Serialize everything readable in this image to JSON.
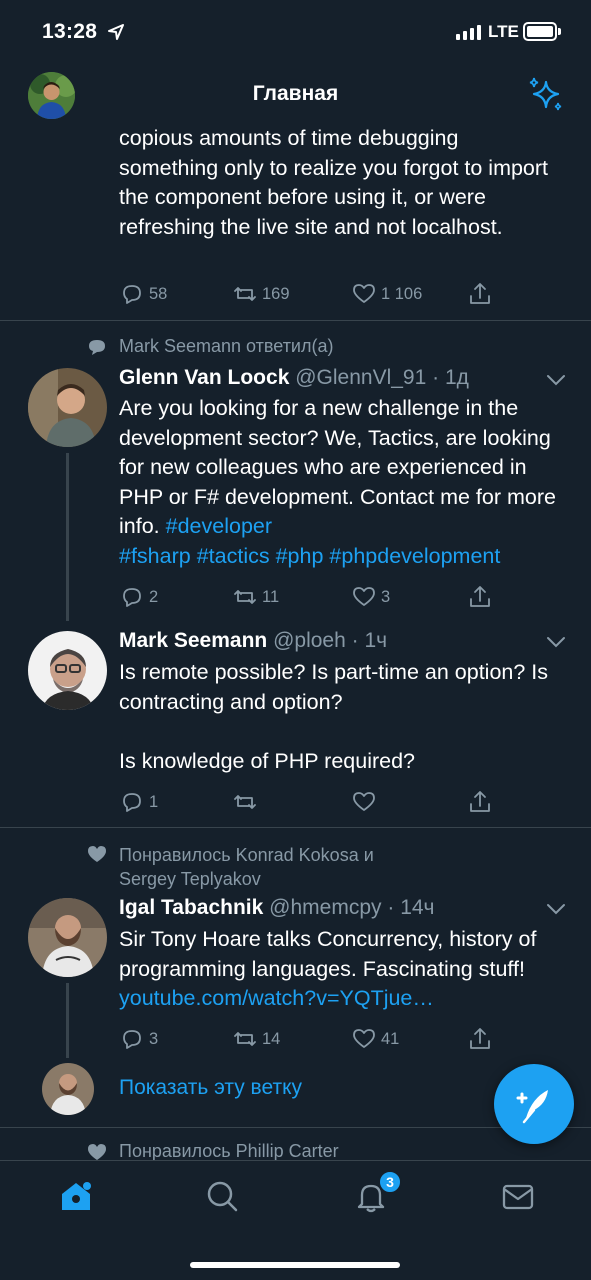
{
  "status_bar": {
    "time": "13:28",
    "network": "LTE"
  },
  "header": {
    "title": "Главная",
    "avatar_icon": "user-avatar",
    "sparkle_icon": "sparkle-icon"
  },
  "tweet_top": {
    "text": "copious amounts of time debugging something only to realize you forgot to import the component before using it, or were refreshing the live site and not localhost.",
    "replies": "58",
    "retweets": "169",
    "likes": "1 106"
  },
  "thread1": {
    "social_context": "Mark Seemann ответил(а)",
    "tweet1": {
      "name": "Glenn Van Loock",
      "handle": "@GlennVl_91",
      "dot": "·",
      "time": "1д",
      "text": "Are you looking for a new challenge in the development sector? We, Tactics, are looking for new colleagues who are experienced in PHP or F# development. Contact me for more info. ",
      "hashtags": [
        "#developer",
        "#fsharp",
        "#tactics",
        "#php",
        "#phpdevelopment"
      ],
      "replies": "2",
      "retweets": "11",
      "likes": "3"
    },
    "tweet2": {
      "name": "Mark Seemann",
      "handle": "@ploeh",
      "dot": "·",
      "time": "1ч",
      "text": "Is remote possible? Is part-time an option? Is contracting and option?",
      "text2": "Is knowledge of PHP required?",
      "replies": "1",
      "retweets": "",
      "likes": ""
    }
  },
  "thread2": {
    "social_context_line1": "Понравилось Konrad Kokosa и",
    "social_context_line2": "Sergey Teplyakov",
    "tweet": {
      "name": "Igal Tabachnik",
      "handle": "@hmemcpy",
      "dot": "·",
      "time": "14ч",
      "text": "Sir Tony Hoare talks Concurrency, history of programming languages. Fascinating stuff! ",
      "link": "youtube.com/watch?v=YQTjue…",
      "replies": "3",
      "retweets": "14",
      "likes": "41"
    },
    "show_thread": "Показать эту ветку"
  },
  "next": {
    "social_context": "Понравилось Phillip Carter"
  },
  "tabbar": {
    "notifications_badge": "3"
  },
  "colors": {
    "background": "#15202b",
    "accent": "#1da1f2",
    "muted": "#8899a6",
    "divider": "#38444d"
  }
}
